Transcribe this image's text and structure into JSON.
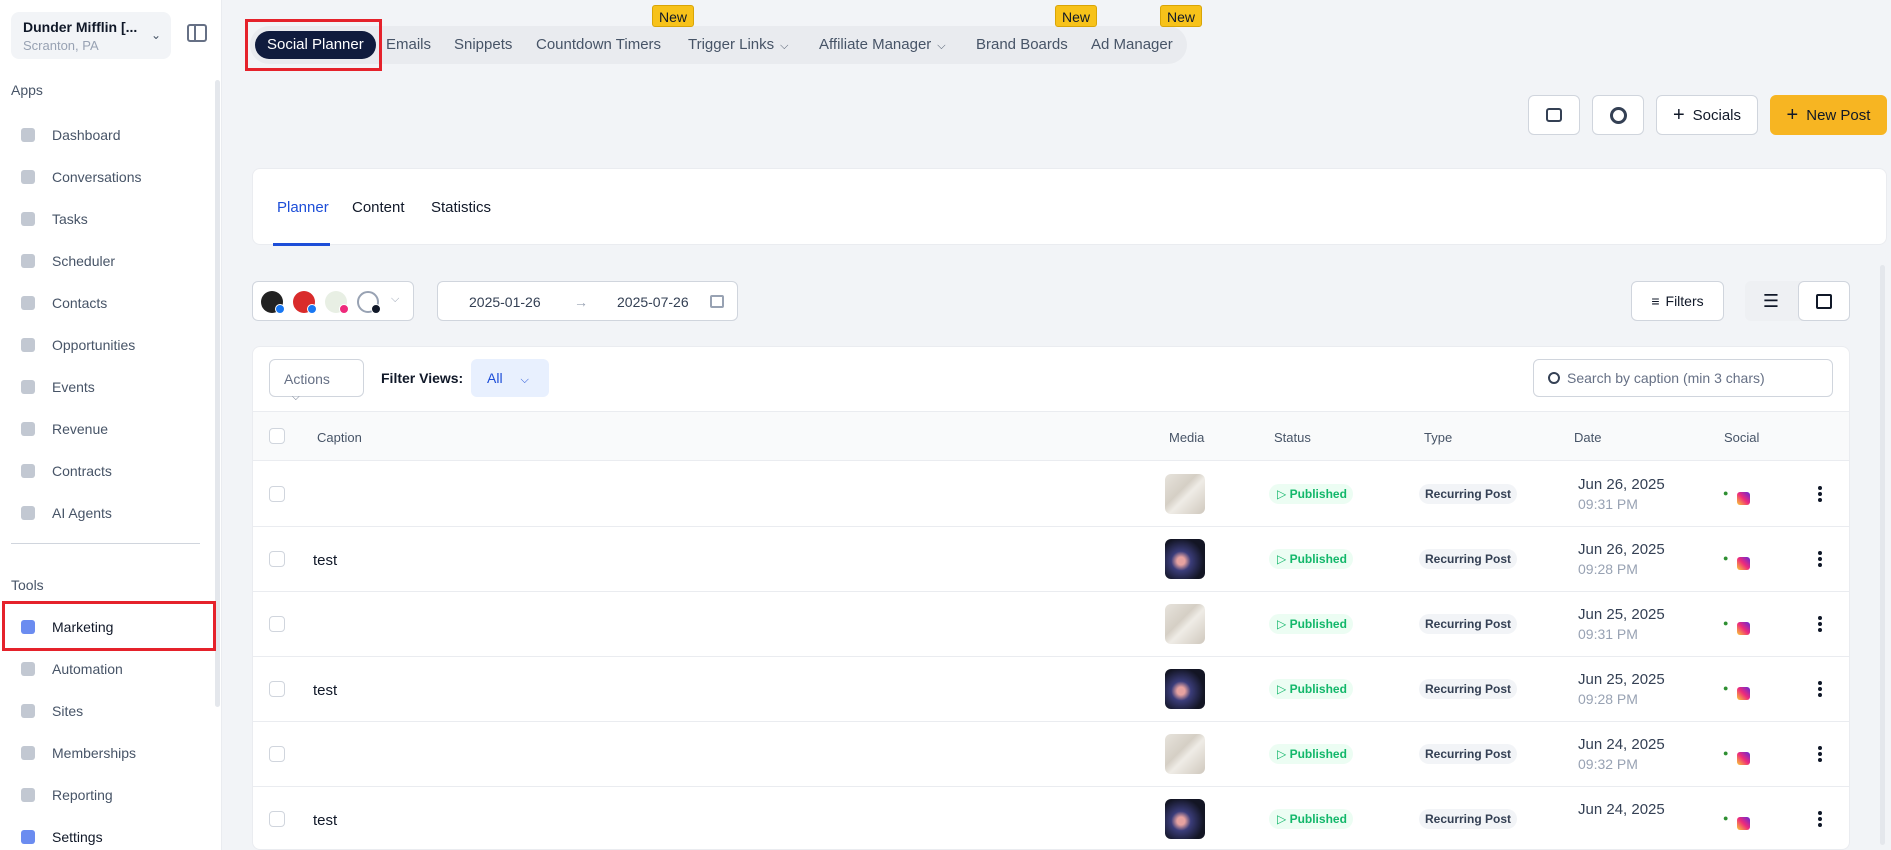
{
  "sidebar": {
    "company_name": "Dunder Mifflin [...",
    "company_location": "Scranton, PA",
    "apps_label": "Apps",
    "apps": [
      {
        "label": "Dashboard",
        "icon": "dashboard-icon"
      },
      {
        "label": "Conversations",
        "icon": "chat-icon"
      },
      {
        "label": "Tasks",
        "icon": "tasks-icon"
      },
      {
        "label": "Scheduler",
        "icon": "calendar-icon"
      },
      {
        "label": "Contacts",
        "icon": "user-icon"
      },
      {
        "label": "Opportunities",
        "icon": "target-icon"
      },
      {
        "label": "Events",
        "icon": "events-icon"
      },
      {
        "label": "Revenue",
        "icon": "card-icon"
      },
      {
        "label": "Contracts",
        "icon": "document-icon"
      },
      {
        "label": "AI Agents",
        "icon": "sparkle-icon"
      }
    ],
    "tools_label": "Tools",
    "tools": [
      {
        "label": "Marketing",
        "icon": "megaphone-icon",
        "active": true
      },
      {
        "label": "Automation",
        "icon": "gears-icon"
      },
      {
        "label": "Sites",
        "icon": "globe-icon"
      },
      {
        "label": "Memberships",
        "icon": "users-icon"
      },
      {
        "label": "Reporting",
        "icon": "pie-icon"
      },
      {
        "label": "Settings",
        "icon": "gear-icon"
      }
    ]
  },
  "top_tabs": [
    {
      "label": "Social Planner",
      "active": true
    },
    {
      "label": "Emails"
    },
    {
      "label": "Snippets"
    },
    {
      "label": "Countdown Timers",
      "badge": "New"
    },
    {
      "label": "Trigger Links",
      "dropdown": true
    },
    {
      "label": "Affiliate Manager",
      "dropdown": true
    },
    {
      "label": "Brand Boards",
      "badge": "New"
    },
    {
      "label": "Ad Manager",
      "badge": "New"
    }
  ],
  "toolbar": {
    "socials_label": "Socials",
    "new_post_label": "New Post"
  },
  "subtabs": [
    "Planner",
    "Content",
    "Statistics"
  ],
  "filters": {
    "date_from": "2025-01-26",
    "date_to": "2025-07-26",
    "filters_label": "Filters",
    "actions_label": "Actions",
    "filter_views_label": "Filter Views:",
    "filter_views_value": "All",
    "search_placeholder": "Search by caption (min 3 chars)"
  },
  "table": {
    "columns": [
      "Caption",
      "Media",
      "Status",
      "Type",
      "Date",
      "Social"
    ],
    "rows": [
      {
        "caption": "",
        "media": "light",
        "status": "Published",
        "type": "Recurring Post",
        "date": "Jun 26, 2025",
        "time": "09:31 PM"
      },
      {
        "caption": "test",
        "media": "dark",
        "status": "Published",
        "type": "Recurring Post",
        "date": "Jun 26, 2025",
        "time": "09:28 PM"
      },
      {
        "caption": "",
        "media": "light",
        "status": "Published",
        "type": "Recurring Post",
        "date": "Jun 25, 2025",
        "time": "09:31 PM"
      },
      {
        "caption": "test",
        "media": "dark",
        "status": "Published",
        "type": "Recurring Post",
        "date": "Jun 25, 2025",
        "time": "09:28 PM"
      },
      {
        "caption": "",
        "media": "light",
        "status": "Published",
        "type": "Recurring Post",
        "date": "Jun 24, 2025",
        "time": "09:32 PM"
      },
      {
        "caption": "test",
        "media": "dark",
        "status": "Published",
        "type": "Recurring Post",
        "date": "Jun 24, 2025",
        "time": ""
      }
    ]
  },
  "colors": {
    "accent_blue": "#1d4ed8",
    "primary_yellow": "#f7b522",
    "highlight_red": "#e5222b",
    "published_green": "#12b76a",
    "active_tab_navy": "#101c3e"
  }
}
